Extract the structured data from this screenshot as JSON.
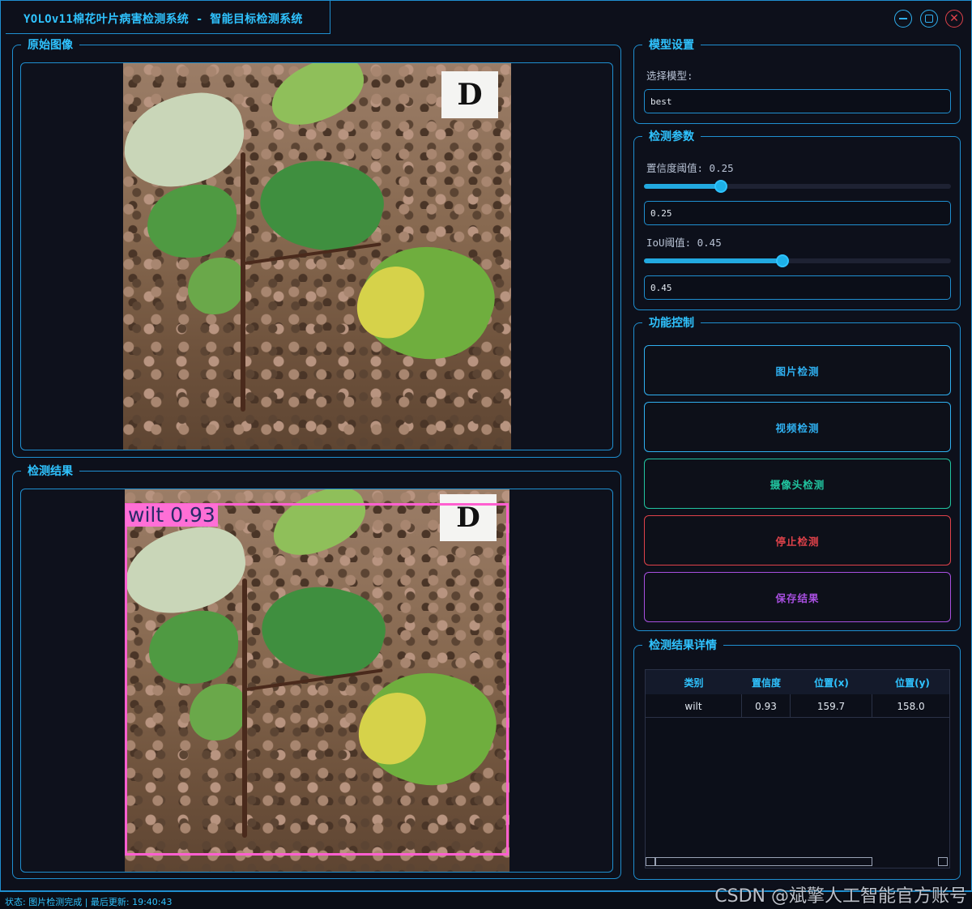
{
  "window": {
    "title": "YOLOv11棉花叶片病害检测系统 - 智能目标检测系统",
    "accent": "#2fc3ff",
    "border_color": "#1f8fd0",
    "close_color": "#e0424a",
    "controls": {
      "minimize_icon": "minus-icon",
      "maximize_icon": "square-icon",
      "close_icon": "x-icon",
      "close_glyph": "✕"
    }
  },
  "original_panel": {
    "title": "原始图像",
    "badge": "D"
  },
  "result_panel": {
    "title": "检测结果",
    "badge": "D",
    "detection_label": "wilt 0.93",
    "box_color": "#ff5fd0"
  },
  "model_settings": {
    "title": "模型设置",
    "select_label": "选择模型:",
    "selected_model": "best"
  },
  "detection_params": {
    "title": "检测参数",
    "confidence_label": "置信度阈值: 0.25",
    "confidence_value": "0.25",
    "confidence_fraction": 0.25,
    "iou_label": "IoU阈值: 0.45",
    "iou_value": "0.45",
    "iou_fraction": 0.45
  },
  "function_control": {
    "title": "功能控制",
    "buttons": [
      {
        "label": "图片检测",
        "color": "#2fb0f0"
      },
      {
        "label": "视频检测",
        "color": "#2fb0f0"
      },
      {
        "label": "摄像头检测",
        "color": "#21c5a0"
      },
      {
        "label": "停止检测",
        "color": "#e0424a"
      },
      {
        "label": "保存结果",
        "color": "#a84fe0"
      }
    ]
  },
  "results_detail": {
    "title": "检测结果详情",
    "columns": [
      "类别",
      "置信度",
      "位置(x)",
      "位置(y)"
    ],
    "rows": [
      [
        "wilt",
        "0.93",
        "159.7",
        "158.0"
      ]
    ]
  },
  "status": {
    "text": "状态: 图片检测完成 | 最后更新: 19:40:43"
  },
  "watermark": "CSDN @斌擎人工智能官方账号"
}
